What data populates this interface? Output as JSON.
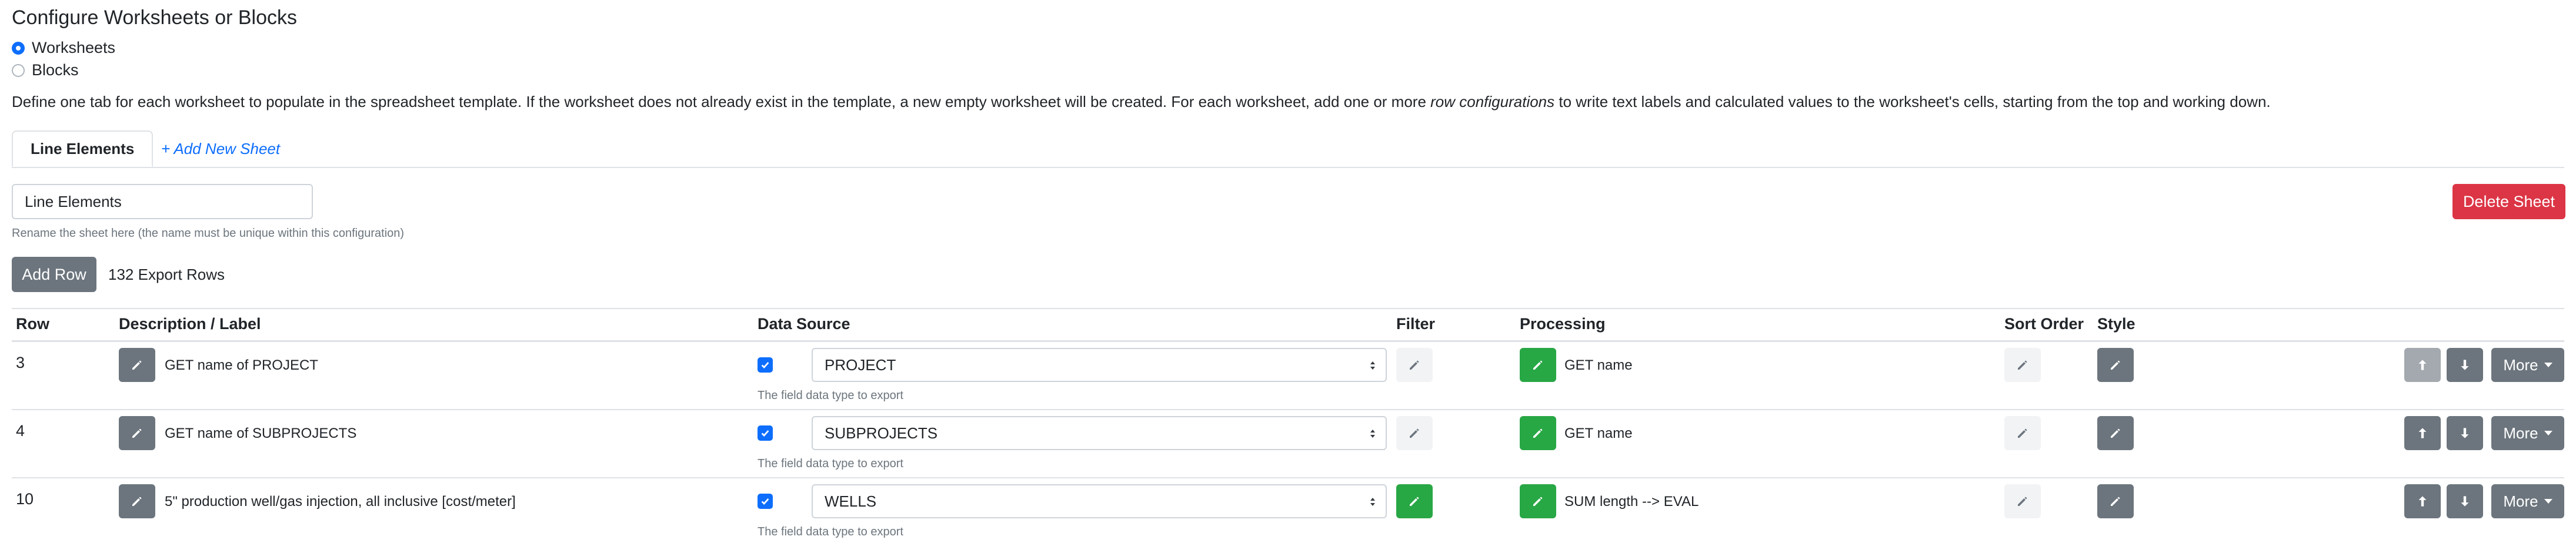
{
  "page": {
    "title": "Configure Worksheets or Blocks",
    "mode_options": [
      {
        "label": "Worksheets",
        "checked": true
      },
      {
        "label": "Blocks",
        "checked": false
      }
    ],
    "description_before": "Define one tab for each worksheet to populate in the spreadsheet template. If the worksheet does not already exist in the template, a new empty worksheet will be created. For each worksheet, add one or more ",
    "description_em": "row configurations",
    "description_after": " to write text labels and calculated values to the worksheet's cells, starting from the top and working down."
  },
  "tabs": {
    "active_label": "Line Elements",
    "add_label": "+ Add New Sheet"
  },
  "sheet": {
    "name_value": "Line Elements",
    "name_help": "Rename the sheet here (the name must be unique within this configuration)",
    "delete_label": "Delete Sheet",
    "add_row_label": "Add Row",
    "export_rows": "132 Export Rows"
  },
  "table": {
    "headers": {
      "row": "Row",
      "label": "Description / Label",
      "source": "Data Source",
      "filter": "Filter",
      "processing": "Processing",
      "sort": "Sort Order",
      "style": "Style"
    },
    "rows": [
      {
        "row": "3",
        "label": "GET name of PROJECT",
        "source": "PROJECT",
        "source_help": "The field data type to export",
        "filter_active": false,
        "processing": "GET name",
        "up_disabled": true,
        "more": "More"
      },
      {
        "row": "4",
        "label": "GET name of SUBPROJECTS",
        "source": "SUBPROJECTS",
        "source_help": "The field data type to export",
        "filter_active": false,
        "processing": "GET name",
        "up_disabled": false,
        "more": "More"
      },
      {
        "row": "10",
        "label": "5\" production well/gas injection, all inclusive [cost/meter]",
        "source": "WELLS",
        "source_help": "The field data type to export",
        "filter_active": true,
        "processing": "SUM length --> EVAL",
        "up_disabled": false,
        "more": "More"
      }
    ]
  },
  "icons": {
    "edit": "pencil-icon",
    "check": "checkmark-icon",
    "up": "arrow-up-icon",
    "down": "arrow-down-icon",
    "select_caret": "select-caret-icon"
  },
  "colors": {
    "primary": "#0d6efd",
    "secondary": "#6c757d",
    "success": "#28a745",
    "danger": "#dc3545"
  }
}
